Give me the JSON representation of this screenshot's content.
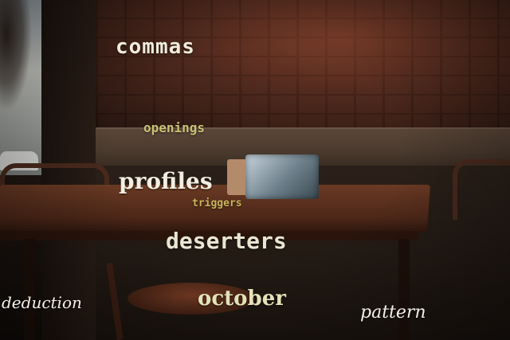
{
  "overlay_words": {
    "commas": "commas",
    "openings": "openings",
    "profiles": "profiles",
    "triggers": "triggers",
    "deserters": "deserters",
    "october": "october",
    "deduction": "deduction",
    "pattern": "pattern"
  },
  "colors": {
    "brick": "#b2563a",
    "wood": "#6a3a24",
    "text_light": "#f1ecdd",
    "text_yellow": "#c9c277"
  }
}
